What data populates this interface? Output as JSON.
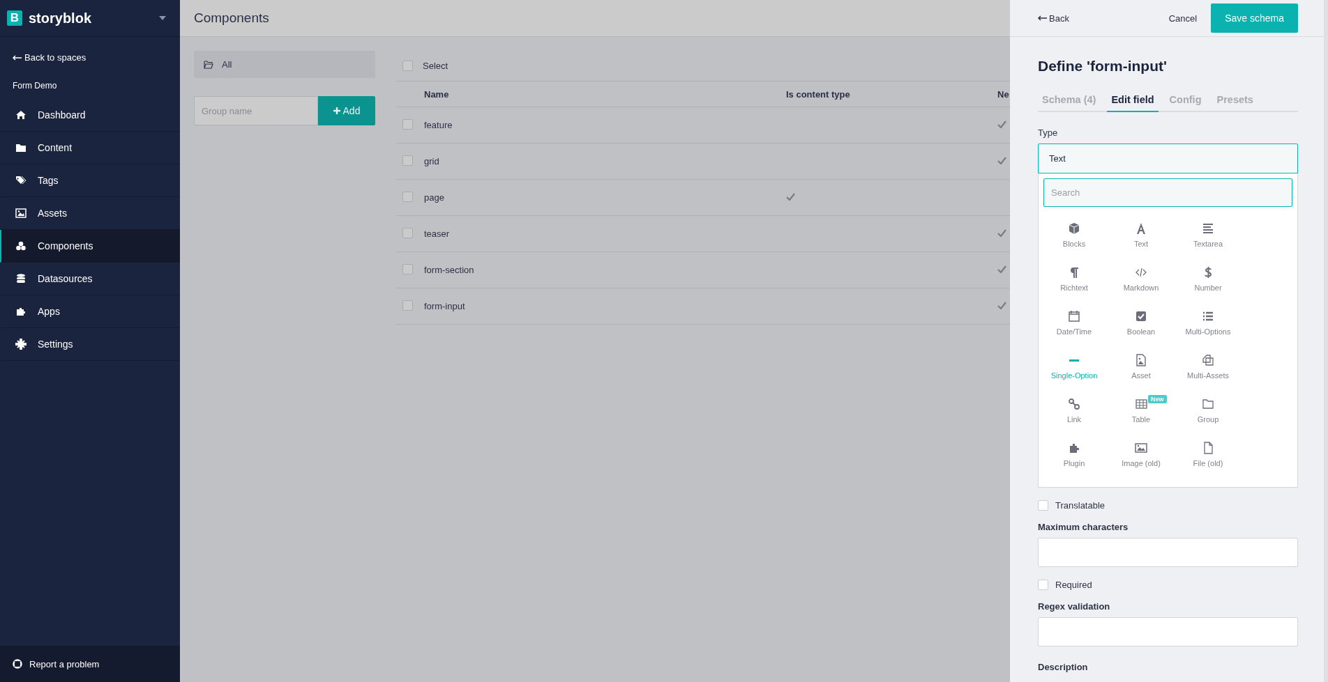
{
  "sidebar": {
    "logo": {
      "mark": "B",
      "name": "storyblok"
    },
    "back_link": "Back to spaces",
    "space_name": "Form Demo",
    "items": [
      {
        "label": "Dashboard",
        "selected": false
      },
      {
        "label": "Content",
        "selected": false
      },
      {
        "label": "Tags",
        "selected": false
      },
      {
        "label": "Assets",
        "selected": false
      },
      {
        "label": "Components",
        "selected": true
      },
      {
        "label": "Datasources",
        "selected": false
      },
      {
        "label": "Apps",
        "selected": false
      },
      {
        "label": "Settings",
        "selected": false
      }
    ],
    "footer": "Report a problem"
  },
  "main": {
    "title": "Components",
    "groups": {
      "items": [
        {
          "label": "All"
        }
      ],
      "input_placeholder": "Group name",
      "add_button": "Add"
    },
    "table": {
      "select_label": "Select",
      "select_all_checked": false,
      "columns": [
        "Name",
        "Is content type",
        "Ne"
      ],
      "rows": [
        {
          "name": "feature",
          "checked": false,
          "is_content_type": false,
          "column_3": true
        },
        {
          "name": "grid",
          "checked": false,
          "is_content_type": false,
          "column_3": true
        },
        {
          "name": "page",
          "checked": false,
          "is_content_type": true,
          "column_3": false
        },
        {
          "name": "teaser",
          "checked": false,
          "is_content_type": false,
          "column_3": true
        },
        {
          "name": "form-section",
          "checked": false,
          "is_content_type": false,
          "column_3": true
        },
        {
          "name": "form-input",
          "checked": false,
          "is_content_type": false,
          "column_3": true
        }
      ]
    }
  },
  "panel": {
    "back": "Back",
    "cancel": "Cancel",
    "save": "Save schema",
    "title": "Define 'form-input'",
    "tabs": [
      {
        "label": "Schema (4)",
        "selected": false
      },
      {
        "label": "Edit field",
        "selected": true
      },
      {
        "label": "Config",
        "selected": false
      },
      {
        "label": "Presets",
        "selected": false
      }
    ],
    "type_label": "Type",
    "type_value": "Text",
    "search_placeholder": "Search",
    "types": [
      {
        "label": "Blocks",
        "selected": false
      },
      {
        "label": "Text",
        "selected": false
      },
      {
        "label": "Textarea",
        "selected": false
      },
      {
        "label": "Richtext",
        "selected": false
      },
      {
        "label": "Markdown",
        "selected": false
      },
      {
        "label": "Number",
        "selected": false
      },
      {
        "label": "Date/Time",
        "selected": false
      },
      {
        "label": "Boolean",
        "selected": false
      },
      {
        "label": "Multi-Options",
        "selected": false
      },
      {
        "label": "Single-Option",
        "selected": true
      },
      {
        "label": "Asset",
        "selected": false
      },
      {
        "label": "Multi-Assets",
        "selected": false
      },
      {
        "label": "Link",
        "selected": false
      },
      {
        "label": "Table",
        "selected": false,
        "badge": "New"
      },
      {
        "label": "Group",
        "selected": false
      },
      {
        "label": "Plugin",
        "selected": false
      },
      {
        "label": "Image (old)",
        "selected": false
      },
      {
        "label": "File (old)",
        "selected": false
      }
    ],
    "translatable": {
      "label": "Translatable",
      "checked": false
    },
    "max_chars_label": "Maximum characters",
    "required": {
      "label": "Required",
      "checked": false
    },
    "regex_label": "Regex validation",
    "description_label": "Description"
  }
}
